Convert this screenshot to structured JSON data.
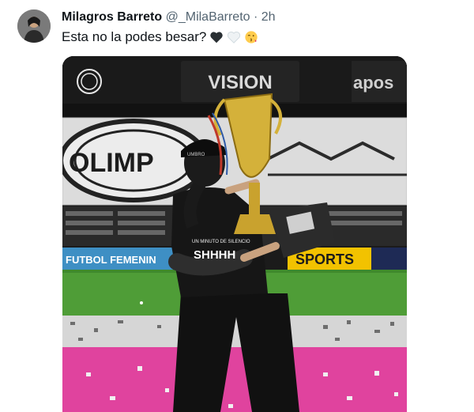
{
  "tweet": {
    "author_name": "Milagros Barreto",
    "author_handle": "@_MilaBarreto",
    "separator": "·",
    "time_ago": "2h",
    "text": "Esta no la podes besar?",
    "emojis": [
      "black-heart-icon",
      "white-heart-icon",
      "face-blowing-kiss-icon"
    ]
  },
  "photo": {
    "banner_vision": "VISION",
    "banner_apos": "apos",
    "stand_text": "OLIMP",
    "ad_sports": "SPORTS",
    "ad_futbol": "FUTBOL FEMENIN",
    "shirt_small": "UN MINUTO DE SILENCIO",
    "shirt_big": "SHHHH",
    "cap_brand": "UMBRO",
    "colors": {
      "pitch": "#4f9d37",
      "stage_pink": "#e0439e",
      "trophy_gold": "#d4b13a",
      "sky_dark": "#111111"
    }
  }
}
